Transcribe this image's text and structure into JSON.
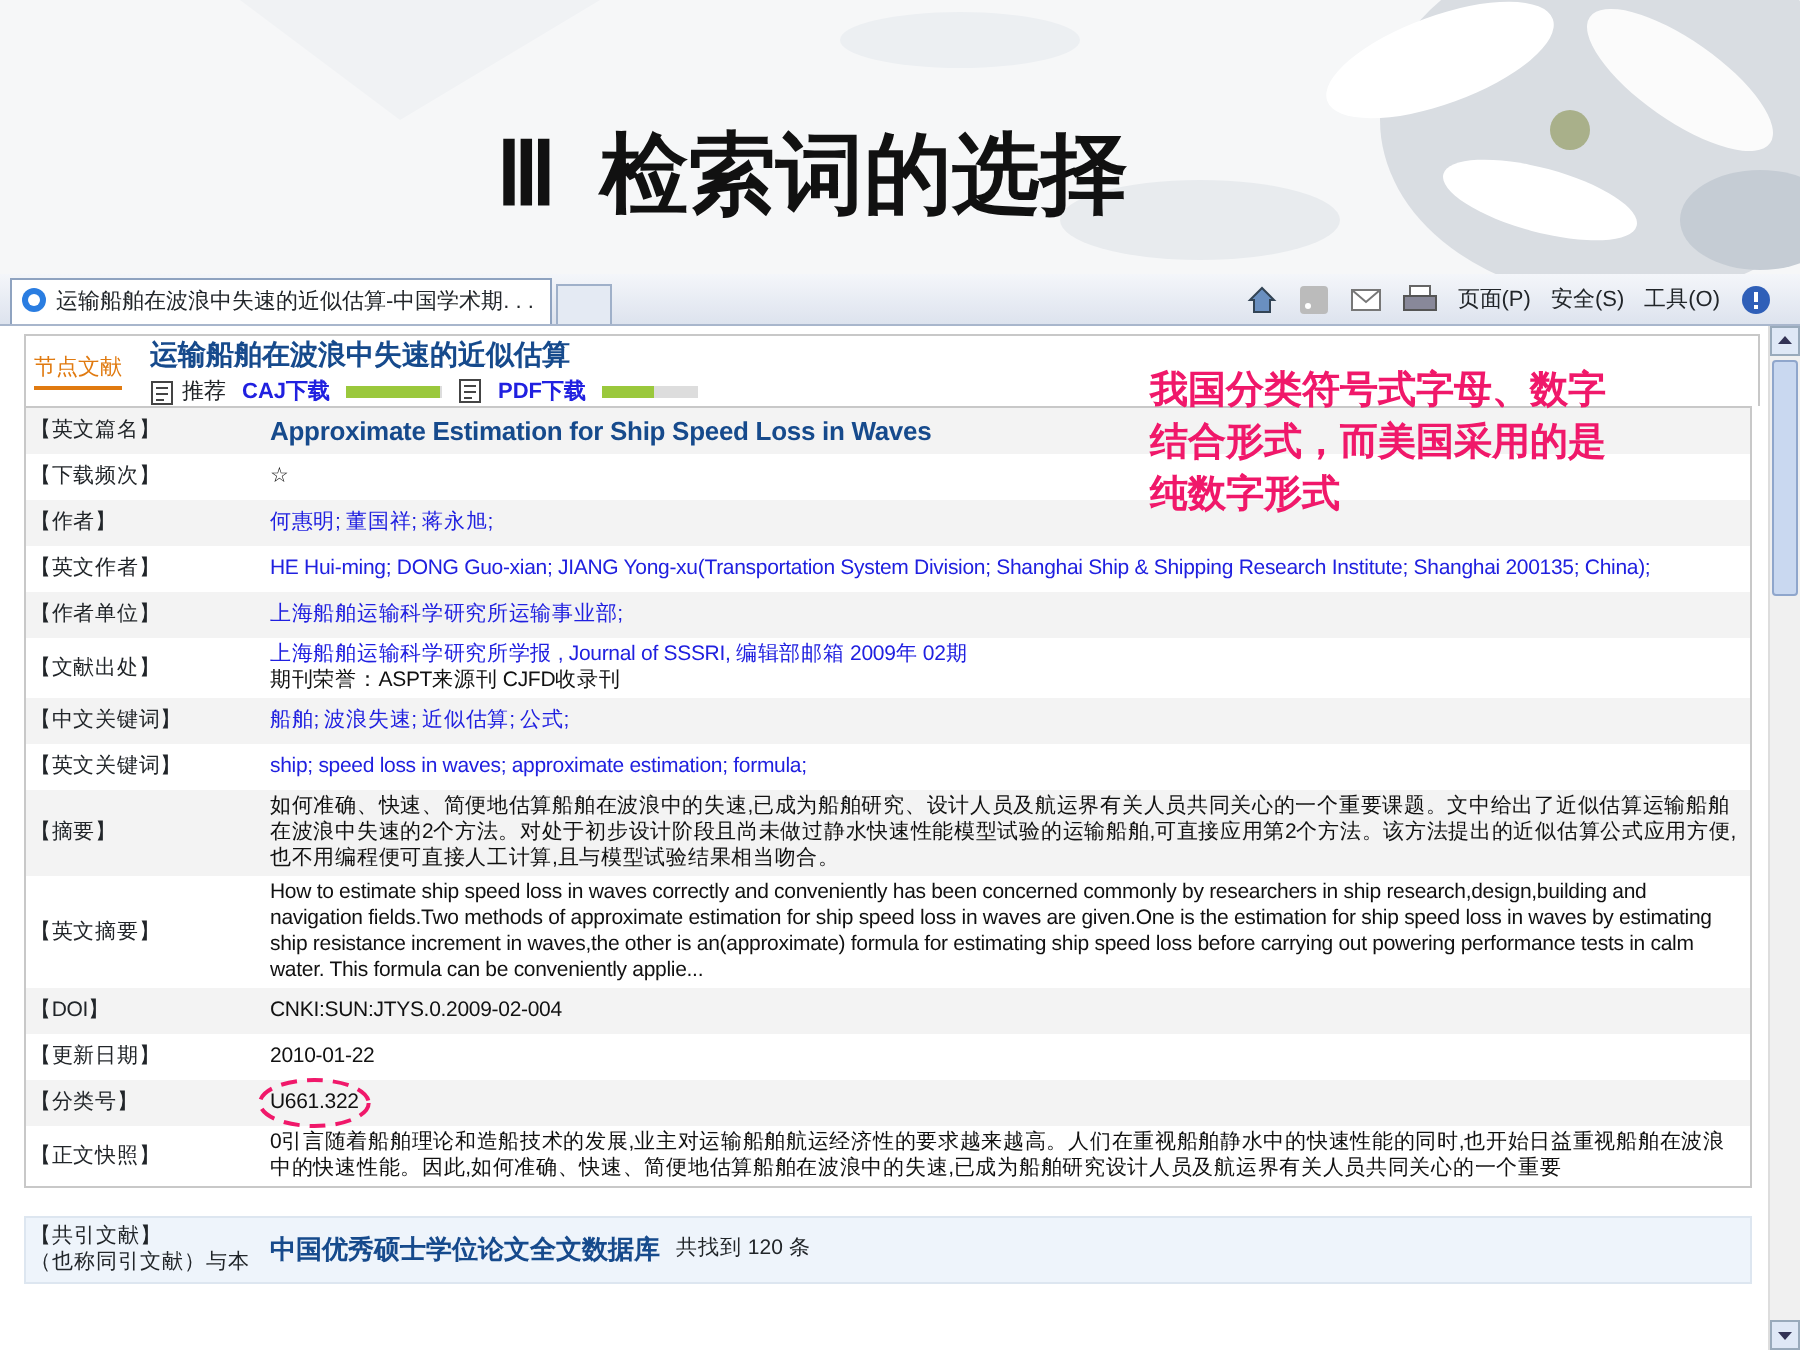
{
  "slide": {
    "title": "Ⅲ  检索词的选择"
  },
  "browser": {
    "tabs": [
      {
        "label": "运输船舶在波浪中失速的近似估算-中国学术期. . .",
        "selected": true
      }
    ],
    "menus": [
      "页面(P)",
      "安全(S)",
      "工具(O)"
    ]
  },
  "record": {
    "logo": "节点文献",
    "title": "运输船舶在波浪中失速的近似估算",
    "recommend": "推荐",
    "downloads": [
      {
        "label": "CAJ下载",
        "level": 0.98
      },
      {
        "label": "PDF下载",
        "level": 0.55
      }
    ],
    "fields": [
      {
        "label": "【英文篇名】",
        "lines": [
          {
            "kind": "title",
            "text": "Approximate Estimation for Ship Speed Loss in Waves"
          }
        ]
      },
      {
        "label": "【下载频次】",
        "lines": [
          {
            "kind": "plain",
            "text": "☆"
          }
        ]
      },
      {
        "label": "【作者】",
        "lines": [
          {
            "kind": "link",
            "text": "何惠明; 董国祥; 蒋永旭;"
          }
        ]
      },
      {
        "label": "【英文作者】",
        "lines": [
          {
            "kind": "link",
            "text": "HE Hui-ming; DONG Guo-xian; JIANG Yong-xu(Transportation System Division; Shanghai Ship & Shipping Research Institute; Shanghai 200135; China);"
          }
        ]
      },
      {
        "label": "【作者单位】",
        "lines": [
          {
            "kind": "link",
            "text": "上海船舶运输科学研究所运输事业部;"
          }
        ]
      },
      {
        "label": "【文献出处】",
        "lines": [
          {
            "kind": "link",
            "text": "上海船舶运输科学研究所学报  , Journal of SSSRI, 编辑部邮箱  2009年  02期"
          },
          {
            "kind": "plain",
            "text": "期刊荣誉：ASPT来源刊  CJFD收录刊"
          }
        ]
      },
      {
        "label": "【中文关键词】",
        "lines": [
          {
            "kind": "link",
            "text": "船舶; 波浪失速; 近似估算; 公式;"
          }
        ]
      },
      {
        "label": "【英文关键词】",
        "lines": [
          {
            "kind": "link",
            "text": "ship; speed loss in waves; approximate estimation; formula;"
          }
        ]
      },
      {
        "label": "【摘要】",
        "lines": [
          {
            "kind": "plain",
            "text": "如何准确、快速、简便地估算船舶在波浪中的失速,已成为船舶研究、设计人员及航运界有关人员共同关心的一个重要课题。文中给出了近似估算运输船舶在波浪中失速的2个方法。对处于初步设计阶段且尚未做过静水快速性能模型试验的运输船舶,可直接应用第2个方法。该方法提出的近似估算公式应用方便,也不用编程便可直接人工计算,且与模型试验结果相当吻合。"
          }
        ]
      },
      {
        "label": "【英文摘要】",
        "lines": [
          {
            "kind": "plain",
            "text": "How to estimate ship speed loss in waves correctly and conveniently has been concerned commonly by researchers in ship research,design,building and navigation fields.Two methods of approximate estimation for ship speed loss in waves are given.One is the estimation for ship speed loss in waves by estimating ship resistance increment in waves,the other is an(approximate) formula for estimating ship speed loss before carrying out powering performance tests in calm water. This formula can be conveniently applie..."
          }
        ]
      },
      {
        "label": "【DOI】",
        "lines": [
          {
            "kind": "plain",
            "text": "CNKI:SUN:JTYS.0.2009-02-004"
          }
        ]
      },
      {
        "label": "【更新日期】",
        "lines": [
          {
            "kind": "plain",
            "text": "2010-01-22"
          }
        ]
      },
      {
        "label": "【分类号】",
        "lines": [
          {
            "kind": "plain",
            "text": "U661.322"
          }
        ],
        "circled": true
      },
      {
        "label": "【正文快照】",
        "lines": [
          {
            "kind": "plain",
            "text": "0引言随着船舶理论和造船技术的发展,业主对运输船舶航运经济性的要求越来越高。人们在重视船舶静水中的快速性能的同时,也开始日益重视船舶在波浪中的快速性能。因此,如何准确、快速、简便地估算船舶在波浪中的失速,已成为船舶研究设计人员及航运界有关人员共同关心的一个重要"
          }
        ]
      }
    ],
    "cocitation": {
      "label": "【共引文献】",
      "note": "（也称同引文献）与本",
      "database": "中国优秀硕士学位论文全文数据库",
      "count": "共找到  120 条"
    }
  },
  "annotation": {
    "lines": [
      "我国分类符号式字母、数字",
      "结合形式，而美国采用的是",
      "纯数字形式"
    ]
  }
}
